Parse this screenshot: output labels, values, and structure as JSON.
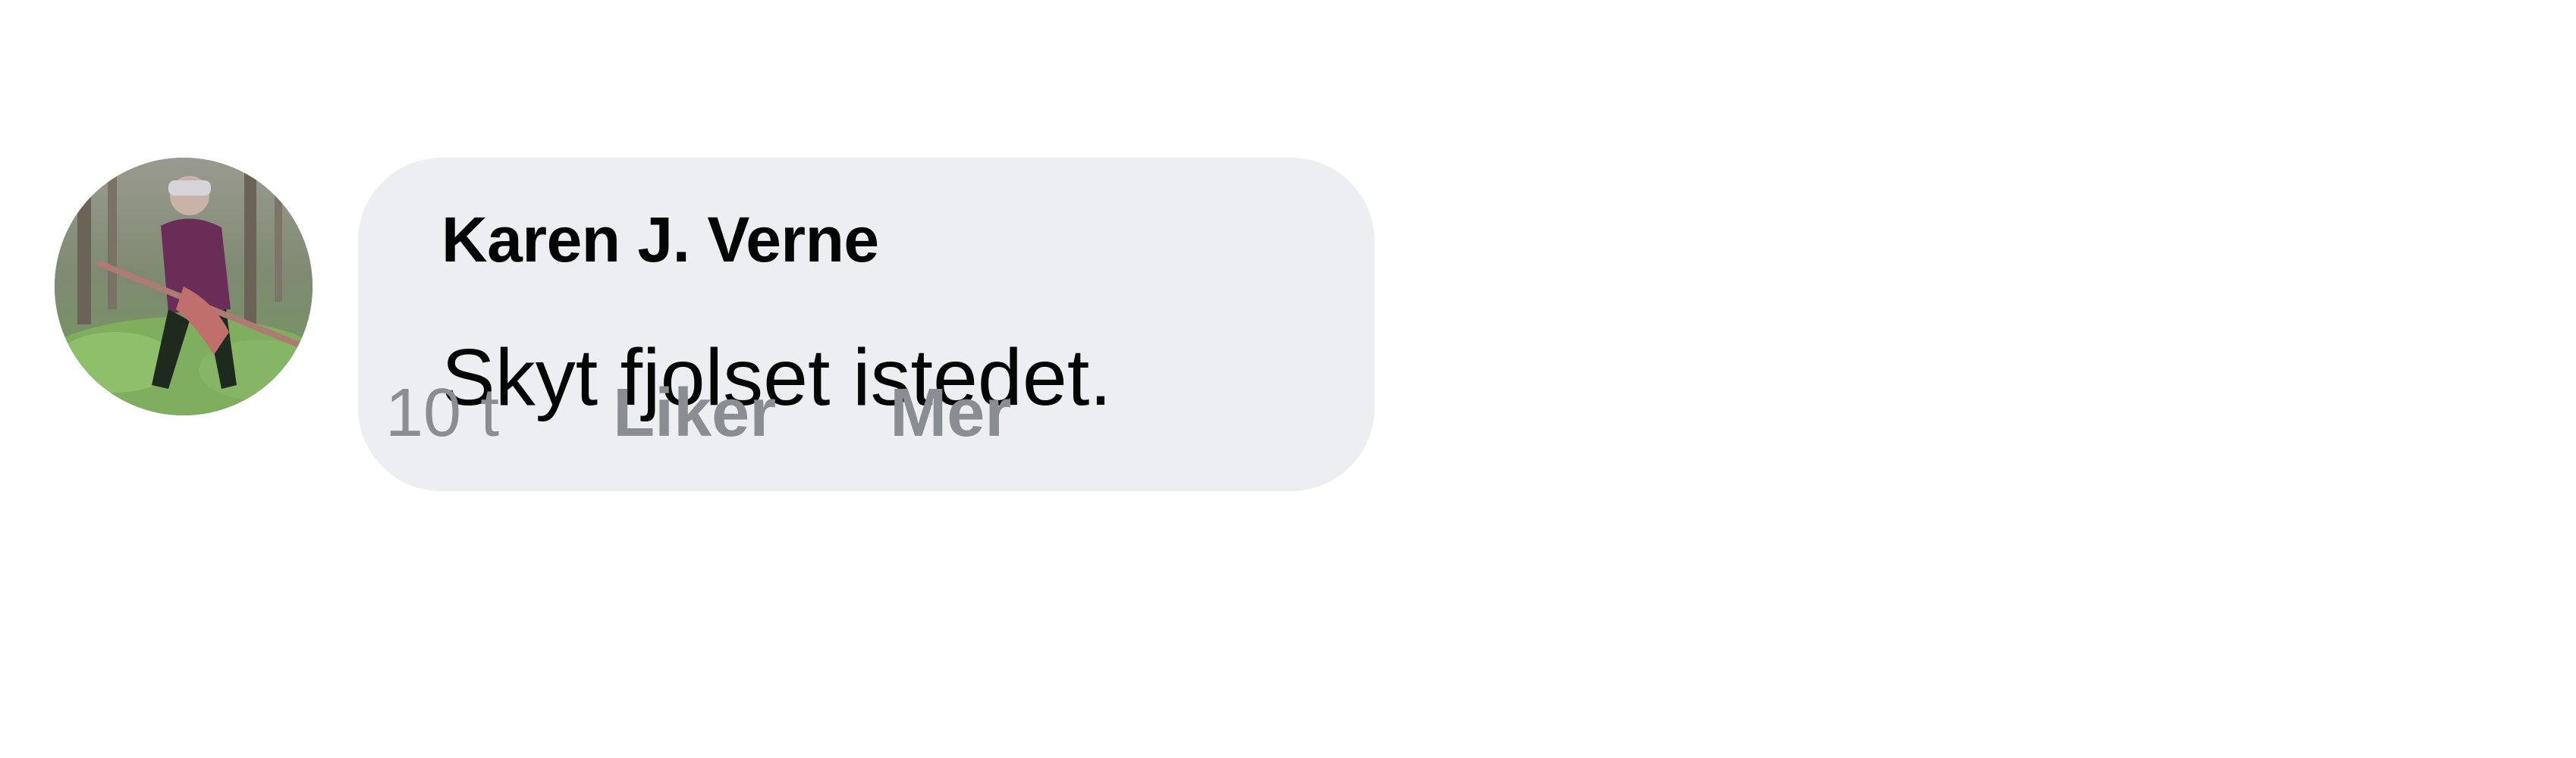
{
  "comment": {
    "author": "Karen J. Verne",
    "text": "Skyt fjolset istedet.",
    "timestamp": "10 t",
    "actions": {
      "like_label": "Liker",
      "more_label": "Mer"
    }
  },
  "colors": {
    "bubble_background": "#eceef1",
    "text_primary": "#050505",
    "text_secondary": "#8a8d91",
    "page_background": "#ffffff"
  }
}
